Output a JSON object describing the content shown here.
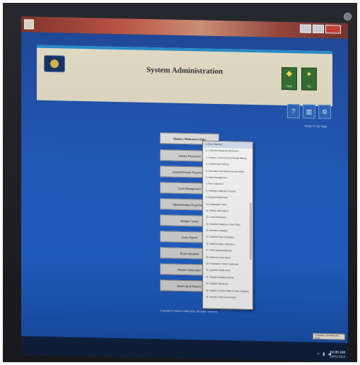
{
  "app": {
    "title": "System Administration",
    "logo_text": "",
    "header_buttons": [
      {
        "label": "Quit",
        "icon": "diamond-sign-icon"
      },
      {
        "label": "Tip",
        "icon": "lightbulb-icon"
      }
    ],
    "help_link": "Press F1 for Help",
    "copyright": "Copyright © Soltech 2006-2024. All rights reserved."
  },
  "toolbar": {
    "icons": [
      "help-icon",
      "calculator-icon",
      "settings-icon"
    ]
  },
  "menu": {
    "items": [
      "Master / Reference Data",
      "Library Personnel",
      "Grade/Periodic Parameters",
      "Card Management",
      "Administrative Registration",
      "Budget Codes",
      "Dues Report",
      "Book Valuation",
      "Report Generation",
      "Back Up & Restore"
    ]
  },
  "dropdown": {
    "items": [
      "1. Book Binding",
      "2. Collection Material Distribution",
      "3. Country, Currency & Exchange Rating",
      "4. Current Rate Setting",
      "5. Circulation and Experimental Media",
      "6. Data Management",
      "7. Fine Collection",
      "8. Holdings Calendar Process",
      "9. Keyword Dictionary",
      "10. Language Codes",
      "11. Library Information",
      "12. Loan Information",
      "13. Material Category / Fine Policy",
      "14. Member Category",
      "15. Material Type Checklists",
      "16. Material Status Definition",
      "17. RFID Data Distribution",
      "18. Rules for Loan Items",
      "19. Publication / Book Catalogue",
      "20. Question Bank Items",
      "21. Subject Heading Listing",
      "22. Subject Thesaurus",
      "23. Subject, Course Table & Data Category",
      "24. Vendor Code Enumeration"
    ]
  },
  "taskbar": {
    "tooltip": "Thursday, 29 February 2024",
    "time": "10:35 AM",
    "date": "29/02/2024"
  }
}
